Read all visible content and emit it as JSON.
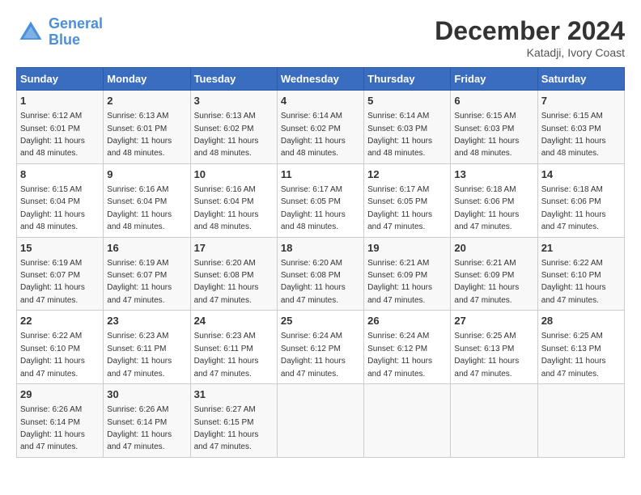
{
  "logo": {
    "line1": "General",
    "line2": "Blue"
  },
  "title": "December 2024",
  "subtitle": "Katadji, Ivory Coast",
  "days_of_week": [
    "Sunday",
    "Monday",
    "Tuesday",
    "Wednesday",
    "Thursday",
    "Friday",
    "Saturday"
  ],
  "weeks": [
    [
      {
        "day": "1",
        "sunrise": "6:12 AM",
        "sunset": "6:01 PM",
        "daylight": "11 hours and 48 minutes."
      },
      {
        "day": "2",
        "sunrise": "6:13 AM",
        "sunset": "6:01 PM",
        "daylight": "11 hours and 48 minutes."
      },
      {
        "day": "3",
        "sunrise": "6:13 AM",
        "sunset": "6:02 PM",
        "daylight": "11 hours and 48 minutes."
      },
      {
        "day": "4",
        "sunrise": "6:14 AM",
        "sunset": "6:02 PM",
        "daylight": "11 hours and 48 minutes."
      },
      {
        "day": "5",
        "sunrise": "6:14 AM",
        "sunset": "6:03 PM",
        "daylight": "11 hours and 48 minutes."
      },
      {
        "day": "6",
        "sunrise": "6:15 AM",
        "sunset": "6:03 PM",
        "daylight": "11 hours and 48 minutes."
      },
      {
        "day": "7",
        "sunrise": "6:15 AM",
        "sunset": "6:03 PM",
        "daylight": "11 hours and 48 minutes."
      }
    ],
    [
      {
        "day": "8",
        "sunrise": "6:15 AM",
        "sunset": "6:04 PM",
        "daylight": "11 hours and 48 minutes."
      },
      {
        "day": "9",
        "sunrise": "6:16 AM",
        "sunset": "6:04 PM",
        "daylight": "11 hours and 48 minutes."
      },
      {
        "day": "10",
        "sunrise": "6:16 AM",
        "sunset": "6:04 PM",
        "daylight": "11 hours and 48 minutes."
      },
      {
        "day": "11",
        "sunrise": "6:17 AM",
        "sunset": "6:05 PM",
        "daylight": "11 hours and 48 minutes."
      },
      {
        "day": "12",
        "sunrise": "6:17 AM",
        "sunset": "6:05 PM",
        "daylight": "11 hours and 47 minutes."
      },
      {
        "day": "13",
        "sunrise": "6:18 AM",
        "sunset": "6:06 PM",
        "daylight": "11 hours and 47 minutes."
      },
      {
        "day": "14",
        "sunrise": "6:18 AM",
        "sunset": "6:06 PM",
        "daylight": "11 hours and 47 minutes."
      }
    ],
    [
      {
        "day": "15",
        "sunrise": "6:19 AM",
        "sunset": "6:07 PM",
        "daylight": "11 hours and 47 minutes."
      },
      {
        "day": "16",
        "sunrise": "6:19 AM",
        "sunset": "6:07 PM",
        "daylight": "11 hours and 47 minutes."
      },
      {
        "day": "17",
        "sunrise": "6:20 AM",
        "sunset": "6:08 PM",
        "daylight": "11 hours and 47 minutes."
      },
      {
        "day": "18",
        "sunrise": "6:20 AM",
        "sunset": "6:08 PM",
        "daylight": "11 hours and 47 minutes."
      },
      {
        "day": "19",
        "sunrise": "6:21 AM",
        "sunset": "6:09 PM",
        "daylight": "11 hours and 47 minutes."
      },
      {
        "day": "20",
        "sunrise": "6:21 AM",
        "sunset": "6:09 PM",
        "daylight": "11 hours and 47 minutes."
      },
      {
        "day": "21",
        "sunrise": "6:22 AM",
        "sunset": "6:10 PM",
        "daylight": "11 hours and 47 minutes."
      }
    ],
    [
      {
        "day": "22",
        "sunrise": "6:22 AM",
        "sunset": "6:10 PM",
        "daylight": "11 hours and 47 minutes."
      },
      {
        "day": "23",
        "sunrise": "6:23 AM",
        "sunset": "6:11 PM",
        "daylight": "11 hours and 47 minutes."
      },
      {
        "day": "24",
        "sunrise": "6:23 AM",
        "sunset": "6:11 PM",
        "daylight": "11 hours and 47 minutes."
      },
      {
        "day": "25",
        "sunrise": "6:24 AM",
        "sunset": "6:12 PM",
        "daylight": "11 hours and 47 minutes."
      },
      {
        "day": "26",
        "sunrise": "6:24 AM",
        "sunset": "6:12 PM",
        "daylight": "11 hours and 47 minutes."
      },
      {
        "day": "27",
        "sunrise": "6:25 AM",
        "sunset": "6:13 PM",
        "daylight": "11 hours and 47 minutes."
      },
      {
        "day": "28",
        "sunrise": "6:25 AM",
        "sunset": "6:13 PM",
        "daylight": "11 hours and 47 minutes."
      }
    ],
    [
      {
        "day": "29",
        "sunrise": "6:26 AM",
        "sunset": "6:14 PM",
        "daylight": "11 hours and 47 minutes."
      },
      {
        "day": "30",
        "sunrise": "6:26 AM",
        "sunset": "6:14 PM",
        "daylight": "11 hours and 47 minutes."
      },
      {
        "day": "31",
        "sunrise": "6:27 AM",
        "sunset": "6:15 PM",
        "daylight": "11 hours and 47 minutes."
      },
      null,
      null,
      null,
      null
    ]
  ]
}
